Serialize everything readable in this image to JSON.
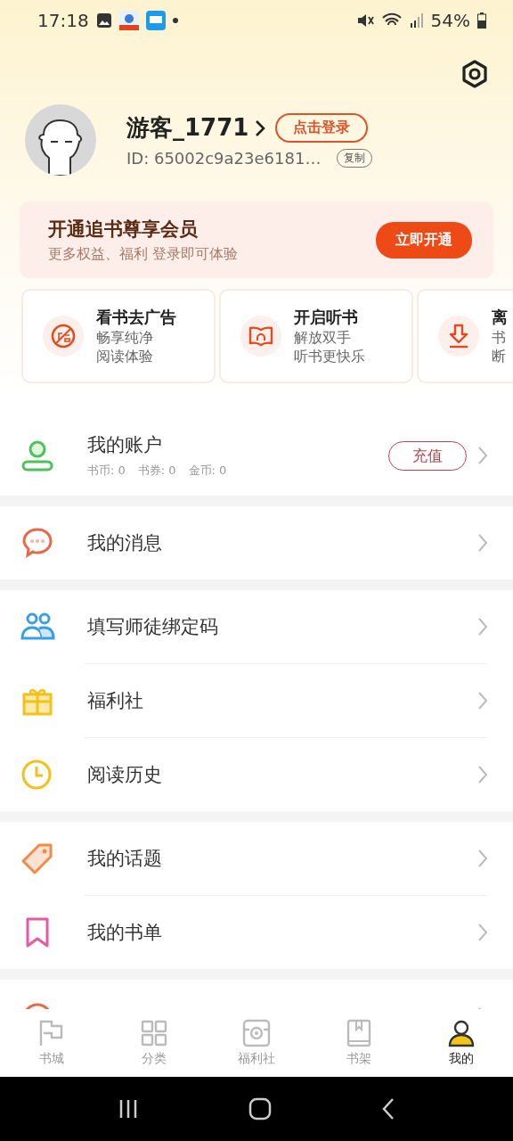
{
  "status_bar": {
    "time": "17:18",
    "battery": "54%"
  },
  "profile": {
    "name": "游客_1771",
    "login_button": "点击登录",
    "id": "ID: 65002c9a23e6181…",
    "copy_button": "复制"
  },
  "vip_banner": {
    "title": "开通追书尊享会员",
    "subtitle": "更多权益、福利 登录即可体验",
    "button": "立即开通"
  },
  "quick_cards": [
    {
      "kind": "noad",
      "title": "看书去广告",
      "lines": [
        "畅享纯净",
        "阅读体验"
      ]
    },
    {
      "kind": "listen",
      "title": "开启听书",
      "lines": [
        "解放双手",
        "听书更快乐"
      ]
    },
    {
      "kind": "download",
      "title": "离",
      "lines": [
        "书",
        "断"
      ]
    }
  ],
  "account": {
    "title": "我的账户",
    "stats": [
      "书币: 0",
      "书券: 0",
      "金币: 0"
    ],
    "recharge_button": "充值"
  },
  "menu_groups": [
    [
      {
        "kind": "message",
        "label": "我的消息"
      }
    ],
    [
      {
        "kind": "mentor",
        "label": "填写师徒绑定码"
      },
      {
        "kind": "gift",
        "label": "福利社"
      },
      {
        "kind": "history",
        "label": "阅读历史"
      }
    ],
    [
      {
        "kind": "topic",
        "label": "我的话题"
      },
      {
        "kind": "booklist",
        "label": "我的书单"
      }
    ],
    [
      {
        "kind": "feedback"
      }
    ]
  ],
  "tabs": [
    {
      "kind": "store",
      "label": "书城",
      "selected": false
    },
    {
      "kind": "category",
      "label": "分类",
      "selected": false
    },
    {
      "kind": "welfare",
      "label": "福利社",
      "selected": false
    },
    {
      "kind": "shelf",
      "label": "书架",
      "selected": false
    },
    {
      "kind": "me",
      "label": "我的",
      "selected": true
    }
  ]
}
